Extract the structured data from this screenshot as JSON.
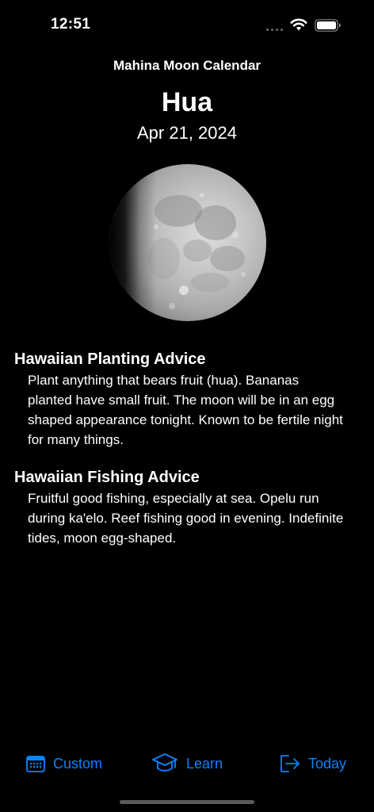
{
  "status_bar": {
    "time": "12:51"
  },
  "header": {
    "app_title": "Mahina Moon Calendar",
    "phase_name": "Hua",
    "date": "Apr 21, 2024"
  },
  "moon": {
    "icon": "moon-phase-image"
  },
  "planting": {
    "heading": "Hawaiian Planting Advice",
    "body": "Plant anything that bears fruit (hua). Bananas planted have small fruit. The moon will be in an egg shaped appearance tonight. Known to be fertile night for many things."
  },
  "fishing": {
    "heading": "Hawaiian Fishing Advice",
    "body": "Fruitful good fishing, especially at sea. Opelu run during ka'elo. Reef fishing good in evening. Indefinite tides, moon egg-shaped."
  },
  "tab_bar": {
    "custom_label": "Custom",
    "learn_label": "Learn",
    "today_label": "Today"
  },
  "colors": {
    "background": "#000000",
    "text": "#ffffff",
    "accent": "#0a84ff"
  }
}
